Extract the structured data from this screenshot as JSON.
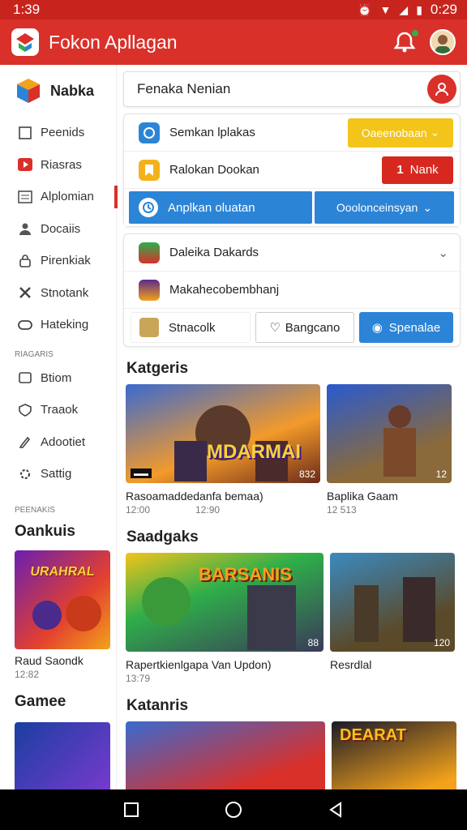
{
  "status": {
    "left_time": "1:39",
    "right_time": "0:29"
  },
  "app": {
    "title": "Fokon Apllagan"
  },
  "sidebar": {
    "brand": "Nabka",
    "items": [
      {
        "label": "Peenids",
        "icon": "document-icon"
      },
      {
        "label": "Riasras",
        "icon": "play-icon"
      },
      {
        "label": "Alplomian",
        "icon": "list-icon"
      },
      {
        "label": "Docaiis",
        "icon": "person-icon"
      },
      {
        "label": "Pirenkiak",
        "icon": "lock-icon"
      },
      {
        "label": "Stnotank",
        "icon": "puzzle-icon"
      },
      {
        "label": "Hateking",
        "icon": "gamepad-icon"
      }
    ],
    "section_1": "RIAGARIS",
    "items_2": [
      {
        "label": "Btiom",
        "icon": "tv-icon"
      },
      {
        "label": "Traaok",
        "icon": "shield-icon"
      },
      {
        "label": "Adootiet",
        "icon": "edit-icon"
      },
      {
        "label": "Sattig",
        "icon": "settings-icon"
      }
    ],
    "section_2": "PEENAKIS",
    "heading_1": "Oankuis",
    "card_1": {
      "title": "Raud Saondk",
      "time": "12:82"
    },
    "heading_2": "Gamee"
  },
  "search": {
    "value": "Fenaka Nenian"
  },
  "panel": {
    "row1": {
      "label": "Semkan lplakas",
      "button": "Oaeenobaan"
    },
    "row2": {
      "label": "Ralokan Dookan",
      "button": "Nank",
      "button_num": "1"
    },
    "row3": {
      "label": "Anplkan oluatan",
      "dropdown": "Ooolonceinsyan"
    }
  },
  "panel2": {
    "row1": {
      "label": "Daleika Dakards"
    },
    "row2": {
      "label": "Makahecobembhanj"
    },
    "buttons": {
      "b1": "Stnacolk",
      "b2": "Bangcano",
      "b3": "Spenalae"
    }
  },
  "sections": {
    "s1": {
      "title": "Katgeris",
      "tile1": {
        "art": "MDARMAI",
        "num": "832",
        "caption": "Rasoamaddedanfa bemaa)",
        "t1": "12:00",
        "t2": "12:90"
      },
      "tile2": {
        "num": "12",
        "caption": "Baplika Gaam",
        "t1": "12 513"
      }
    },
    "s2": {
      "title": "Saadgaks",
      "tile1": {
        "art": "BARSANIS",
        "num": "88",
        "caption": "Rapertkienlgapa Van Updon)",
        "t1": "13:79"
      },
      "tile2": {
        "num": "120",
        "caption": "Resrdlal"
      }
    },
    "s3": {
      "title": "Katanris",
      "tile3": {
        "art": "DEARAT"
      }
    }
  },
  "side_card_art": "URAHRAL",
  "colors": {
    "accent": "#d9302a",
    "blue": "#2c84d6",
    "yellow": "#f3c41a"
  }
}
